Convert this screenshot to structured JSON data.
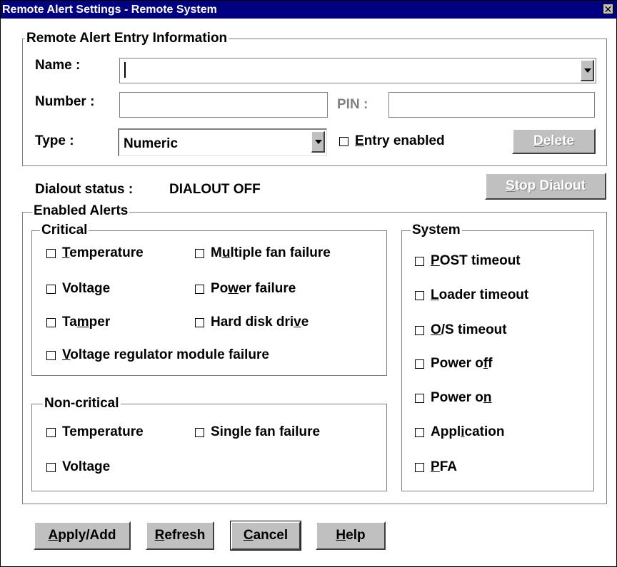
{
  "window": {
    "title": "Remote Alert Settings - Remote System",
    "close_glyph": "✕"
  },
  "entry": {
    "group_label": "Remote Alert Entry Information",
    "name_label": "Name :",
    "name_value": "",
    "number_label": "Number :",
    "number_value": "",
    "pin_label": "PIN :",
    "pin_value": "",
    "type_label": "Type :",
    "type_value": "Numeric",
    "entry_enabled": {
      "pre": "",
      "u": "E",
      "post": "ntry enabled",
      "checked": false
    },
    "delete_button": {
      "pre": "",
      "u": "D",
      "post": "elete",
      "enabled": false
    }
  },
  "dialout": {
    "status_label": "Dialout status :",
    "status_value": "DIALOUT OFF",
    "stop_button": {
      "pre": "",
      "u": "S",
      "post": "top Dialout",
      "enabled": false
    }
  },
  "alerts": {
    "group_label": "Enabled Alerts",
    "critical": {
      "label": "Critical",
      "items": [
        {
          "pre": "",
          "u": "T",
          "post": "emperature",
          "checked": false
        },
        {
          "pre": "M",
          "u": "u",
          "post": "ltiple fan failure",
          "checked": false
        },
        {
          "pre": "Voltage",
          "u": "",
          "post": "",
          "checked": false
        },
        {
          "pre": "Po",
          "u": "w",
          "post": "er failure",
          "checked": false
        },
        {
          "pre": "Ta",
          "u": "m",
          "post": "per",
          "checked": false
        },
        {
          "pre": "Hard disk dri",
          "u": "v",
          "post": "e",
          "checked": false
        },
        {
          "pre": "",
          "u": "V",
          "post": "oltage regulator module failure",
          "checked": false
        }
      ]
    },
    "noncritical": {
      "label": "Non-critical",
      "items": [
        {
          "pre": "Temperature",
          "u": "",
          "post": "",
          "checked": false
        },
        {
          "pre": "Single fan failure",
          "u": "",
          "post": "",
          "checked": false
        },
        {
          "pre": "Voltage",
          "u": "",
          "post": "",
          "checked": false
        }
      ]
    },
    "system": {
      "label": "System",
      "items": [
        {
          "pre": "",
          "u": "P",
          "post": "OST timeout",
          "checked": false
        },
        {
          "pre": "",
          "u": "L",
          "post": "oader timeout",
          "checked": false
        },
        {
          "pre": "",
          "u": "O",
          "post": "/S timeout",
          "checked": false
        },
        {
          "pre": "Power o",
          "u": "f",
          "post": "f",
          "checked": false
        },
        {
          "pre": "Power o",
          "u": "n",
          "post": "",
          "checked": false
        },
        {
          "pre": "Appl",
          "u": "i",
          "post": "cation",
          "checked": false
        },
        {
          "pre": "",
          "u": "P",
          "post": "FA",
          "checked": false
        }
      ]
    }
  },
  "buttons": {
    "apply": {
      "pre": "",
      "u": "A",
      "post": "pply/Add"
    },
    "refresh": {
      "pre": "",
      "u": "R",
      "post": "efresh"
    },
    "cancel": {
      "pre": "",
      "u": "C",
      "post": "ancel"
    },
    "help": {
      "pre": "",
      "u": "H",
      "post": "elp"
    }
  },
  "colors": {
    "titlebar": "#000080",
    "button_face": "#c0c0c0",
    "disabled_text": "#808080"
  }
}
